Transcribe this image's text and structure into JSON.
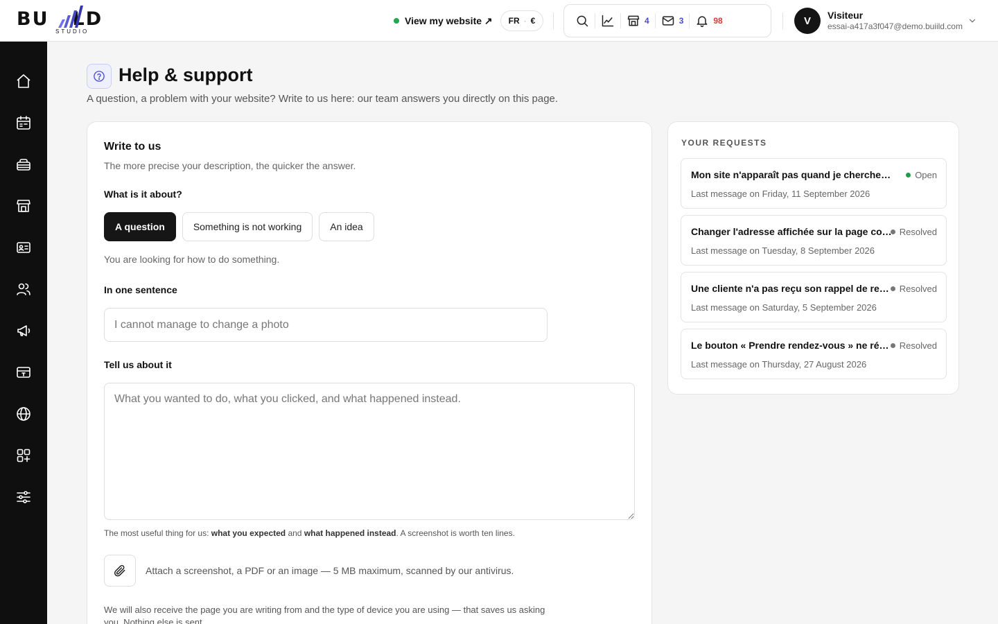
{
  "brand": {
    "name_left": "BU",
    "name_right": "LD",
    "sub": "STUDIO",
    "accent": "#5b5bd6"
  },
  "topbar": {
    "view_site": "View my website ↗",
    "lang": "FR",
    "currency": "€",
    "counts": {
      "stores": "4",
      "messages": "3",
      "notifications": "98"
    },
    "count_colors": {
      "stores": "#4b4bcc",
      "messages": "#4b4bcc",
      "notifications": "#d63a3a"
    }
  },
  "user": {
    "initial": "V",
    "name": "Visiteur",
    "email": "essai-a417a3f047@demo.buiild.com"
  },
  "sidebar": {
    "items": [
      "home-icon",
      "calendar-icon",
      "services-icon",
      "store-icon",
      "contact-card-icon",
      "users-icon",
      "megaphone-icon",
      "payment-card-icon",
      "globe-icon",
      "apps-icon",
      "settings-sliders-icon"
    ]
  },
  "page": {
    "title": "Help & support",
    "subtitle": "A question, a problem with your website? Write to us here: our team answers you directly on this page."
  },
  "form": {
    "title": "Write to us",
    "subtitle": "The more precise your description, the quicker the answer.",
    "topic_label": "What is it about?",
    "topics": [
      {
        "label": "A question",
        "active": true
      },
      {
        "label": "Something is not working",
        "active": false
      },
      {
        "label": "An idea",
        "active": false
      }
    ],
    "topic_hint": "You are looking for how to do something.",
    "sentence_label": "In one sentence",
    "sentence_placeholder": "I cannot manage to change a photo",
    "details_label": "Tell us about it",
    "details_placeholder": "What you wanted to do, what you clicked, and what happened instead.",
    "helper_pre": "The most useful thing for us: ",
    "helper_b1": "what you expected",
    "helper_mid": " and ",
    "helper_b2": "what happened instead",
    "helper_post": ". A screenshot is worth ten lines.",
    "attach_text": "Attach a screenshot, a PDF or an image — 5 MB maximum, scanned by our antivirus.",
    "footnote": "We will also receive the page you are writing from and the type of device you are using — that saves us asking you. Nothing else is sent."
  },
  "requests": {
    "title": "YOUR REQUESTS",
    "items": [
      {
        "subject": "Mon site n'apparaît pas quand je cherche mon nom",
        "status": "Open",
        "status_color": "#1e9e4a",
        "meta": "Last message on Friday, 11 September 2026"
      },
      {
        "subject": "Changer l'adresse affichée sur la page contact",
        "status": "Resolved",
        "status_color": "#777777",
        "meta": "Last message on Tuesday, 8 September 2026"
      },
      {
        "subject": "Une cliente n'a pas reçu son rappel de rendez-vous",
        "status": "Resolved",
        "status_color": "#777777",
        "meta": "Last message on Saturday, 5 September 2026"
      },
      {
        "subject": "Le bouton « Prendre rendez-vous » ne répond plus",
        "status": "Resolved",
        "status_color": "#777777",
        "meta": "Last message on Thursday, 27 August 2026"
      }
    ]
  }
}
